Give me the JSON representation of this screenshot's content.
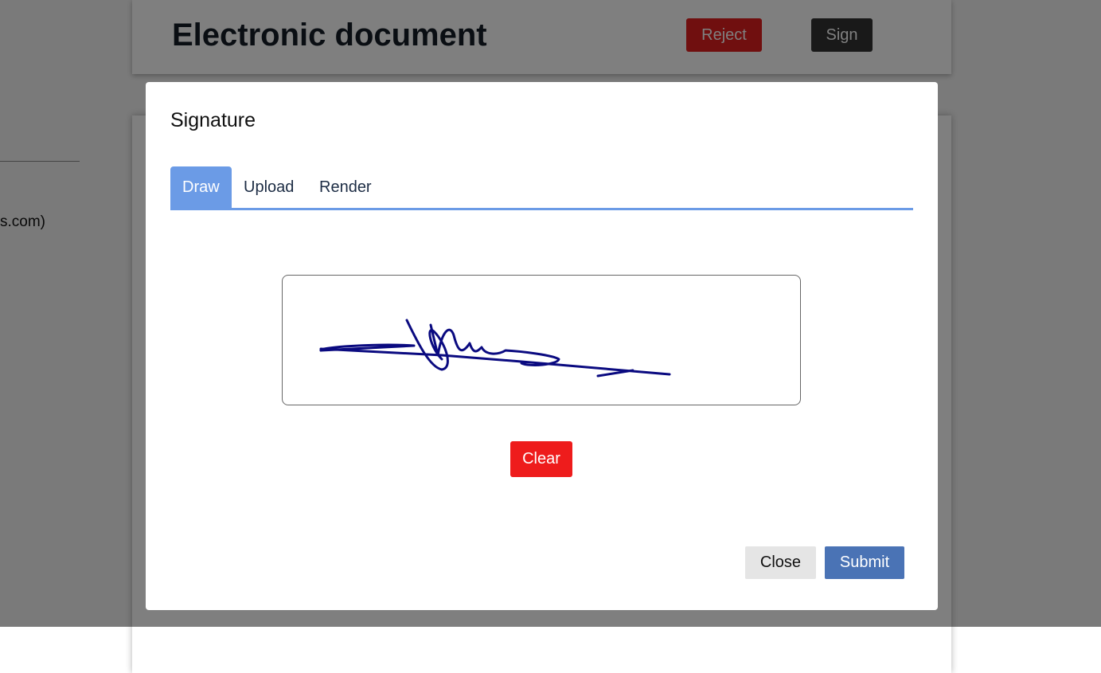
{
  "header": {
    "title": "Electronic document",
    "reject_label": "Reject",
    "sign_label": "Sign"
  },
  "sidebar": {
    "email_fragment": "s.com)"
  },
  "modal": {
    "title": "Signature",
    "tabs": [
      {
        "label": "Draw",
        "active": true
      },
      {
        "label": "Upload",
        "active": false
      },
      {
        "label": "Render",
        "active": false
      }
    ],
    "clear_label": "Clear",
    "close_label": "Close",
    "submit_label": "Submit",
    "ink_color": "#0a0a80"
  }
}
